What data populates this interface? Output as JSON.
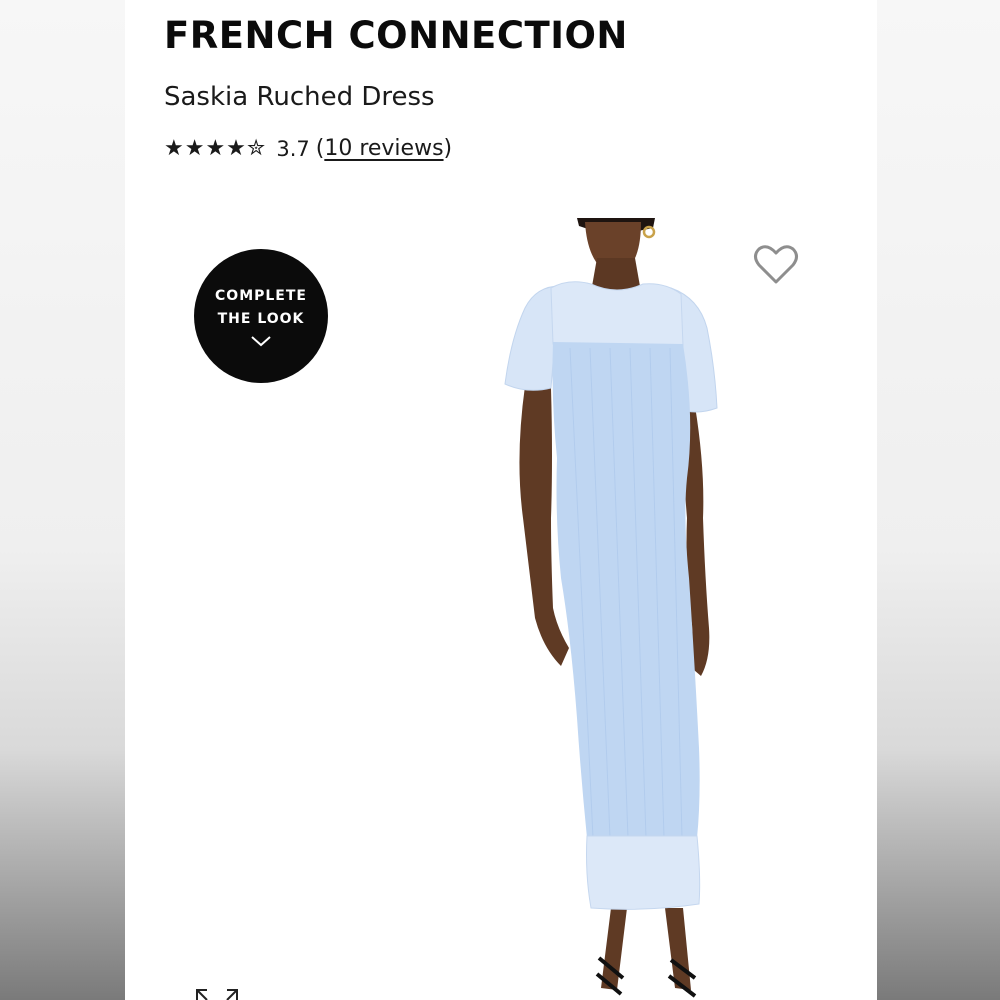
{
  "product": {
    "brand": "FRENCH CONNECTION",
    "name": "Saskia Ruched Dress",
    "rating": {
      "stars_glyphs": "★★★★✮",
      "value": "3.7",
      "reviews_open": "(",
      "reviews_link": "10 reviews",
      "reviews_close": ")"
    }
  },
  "complete_the_look": {
    "line1": "COMPLETE",
    "line2": "THE LOOK",
    "icon": "chevron-down-icon"
  },
  "icons": {
    "wishlist": "heart-outline-icon",
    "expand": "expand-icon"
  },
  "colors": {
    "text": "#0b0b0b",
    "badge_bg": "#0b0b0b",
    "dress": "#bcd5f3",
    "dress_sheer": "#dbe8f8"
  }
}
